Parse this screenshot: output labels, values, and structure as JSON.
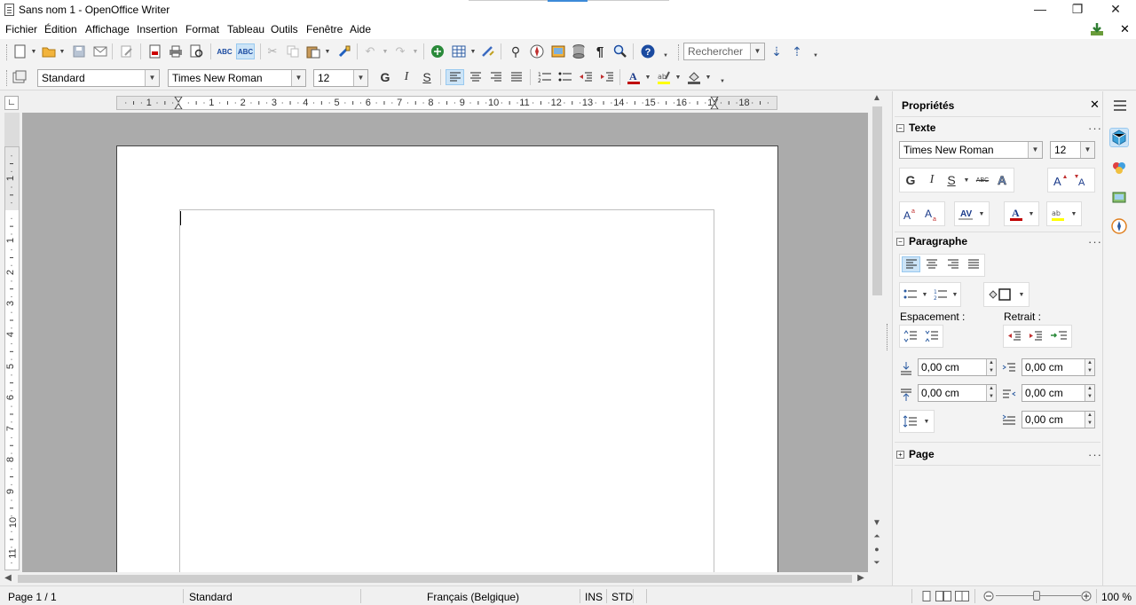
{
  "window": {
    "title": "Sans nom 1 - OpenOffice Writer",
    "minimize": "—",
    "restore": "❐",
    "close": "✕"
  },
  "menu": {
    "items": [
      "Fichier",
      "Édition",
      "Affichage",
      "Insertion",
      "Format",
      "Tableau",
      "Outils",
      "Fenêtre",
      "Aide"
    ],
    "download_icon": "download-icon",
    "close_doc": "✕"
  },
  "toolbar": {
    "search_placeholder": "Rechercher",
    "paragraph_style": "Standard",
    "font_name": "Times New Roman",
    "font_size": "12",
    "bold": "G",
    "italic": "I",
    "underline": "S"
  },
  "ruler": {
    "h_numbers": [
      "1",
      "1",
      "2",
      "3",
      "4",
      "5",
      "6",
      "7",
      "8",
      "9",
      "10",
      "11",
      "12",
      "13",
      "14",
      "15",
      "16",
      "17",
      "18"
    ],
    "v_numbers": [
      "1",
      "1",
      "2",
      "3",
      "4",
      "5",
      "6",
      "7",
      "8",
      "9",
      "10",
      "11"
    ]
  },
  "sidebar": {
    "title": "Propriétés",
    "text_section": "Texte",
    "font_name": "Times New Roman",
    "font_size": "12",
    "bold": "G",
    "italic": "I",
    "underline": "S",
    "strike": "ABC",
    "paragraph_section": "Paragraphe",
    "spacing_label": "Espacement :",
    "indent_label": "Retrait :",
    "above_spacing": "0,00 cm",
    "below_spacing": "0,00 cm",
    "before_indent": "0,00 cm",
    "after_indent": "0,00 cm",
    "first_line_indent": "0,00 cm",
    "page_section": "Page"
  },
  "status": {
    "page": "Page 1 / 1",
    "style": "Standard",
    "language": "Français (Belgique)",
    "insert_mode": "INS",
    "selection_mode": "STD",
    "zoom": "100 %"
  },
  "colors": {
    "accent": "#cce4f7",
    "workspace": "#ababab",
    "font_color": "#c00000",
    "highlight": "#ffff00"
  }
}
